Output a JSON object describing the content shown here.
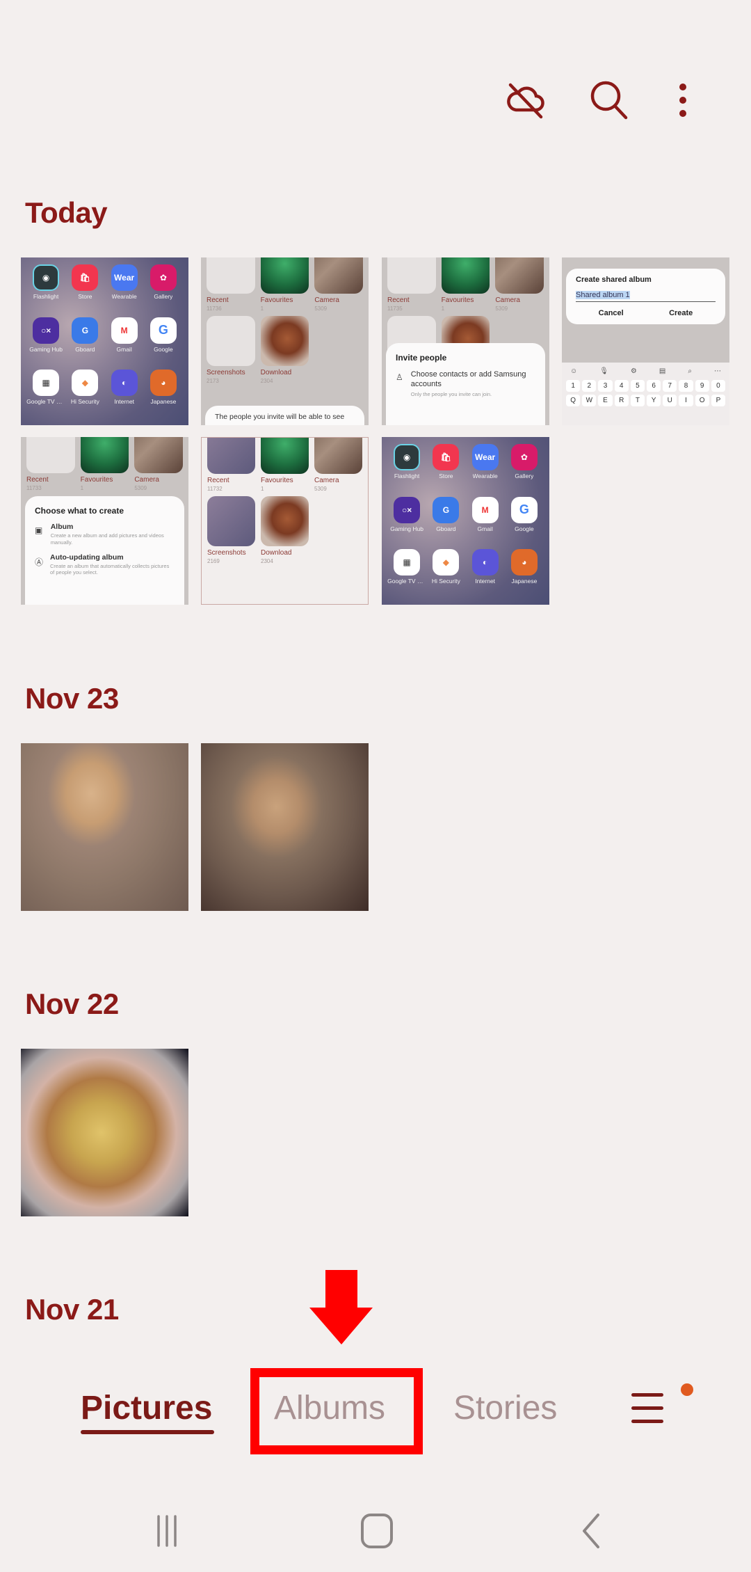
{
  "topbar": {
    "icons": [
      {
        "name": "cloud-off-icon",
        "label": "Cloud sync off"
      },
      {
        "name": "search-icon",
        "label": "Search"
      },
      {
        "name": "more-options-icon",
        "label": "More options"
      }
    ]
  },
  "colors": {
    "accent": "#8b1a18",
    "background": "#f3efee",
    "inactive_tab": "#a89192",
    "badge": "#e05a1f",
    "annotation": "#ff0000"
  },
  "sections": [
    {
      "date": "Today",
      "thumbnails": [
        {
          "kind": "home-screen",
          "apps": [
            "Flashlight",
            "Store",
            "Wearable",
            "Gallery",
            "Gaming Hub",
            "Gboard",
            "Gmail",
            "Google",
            "Google TV Re...",
            "Hi Security",
            "Internet",
            "Japanese"
          ]
        },
        {
          "kind": "albums-with-sheet",
          "albums": [
            {
              "name": "Recent",
              "count": "11736"
            },
            {
              "name": "Favourites",
              "count": "1"
            },
            {
              "name": "Camera",
              "count": "5309"
            },
            {
              "name": "Screenshots",
              "count": "2173"
            },
            {
              "name": "Download",
              "count": "2304"
            }
          ],
          "sheet_text": "The people you invite will be able to see"
        },
        {
          "kind": "invite-people",
          "albums": [
            {
              "name": "Recent",
              "count": "11735"
            },
            {
              "name": "Favourites",
              "count": "1"
            },
            {
              "name": "Camera",
              "count": "5309"
            }
          ],
          "sheet_title": "Invite people",
          "option_title": "Choose contacts or add Samsung accounts",
          "option_desc": "Only the people you invite can join."
        },
        {
          "kind": "create-shared-album",
          "dialog_title": "Create shared album",
          "input_value": "Shared album 1",
          "cancel": "Cancel",
          "create": "Create",
          "keyboard_numbers": [
            "1",
            "2",
            "3",
            "4",
            "5",
            "6",
            "7",
            "8",
            "9",
            "0"
          ],
          "keyboard_letters": [
            "Q",
            "W",
            "E",
            "R",
            "T",
            "Y",
            "U",
            "I",
            "O",
            "P"
          ]
        },
        {
          "kind": "choose-what-to-create",
          "albums": [
            {
              "name": "Recent",
              "count": "11733"
            },
            {
              "name": "Favourites",
              "count": "1"
            },
            {
              "name": "Camera",
              "count": "5309"
            }
          ],
          "sheet_title": "Choose what to create",
          "options": [
            {
              "title": "Album",
              "desc": "Create a new album and add pictures and videos manually."
            },
            {
              "title": "Auto-updating album",
              "desc": "Create an album that automatically collects pictures of people you select."
            }
          ]
        },
        {
          "kind": "albums-grid",
          "albums": [
            {
              "name": "Recent",
              "count": "11732"
            },
            {
              "name": "Favourites",
              "count": "1"
            },
            {
              "name": "Camera",
              "count": "5309"
            },
            {
              "name": "Screenshots",
              "count": "2169"
            },
            {
              "name": "Download",
              "count": "2304"
            }
          ]
        },
        {
          "kind": "home-screen",
          "apps": [
            "Flashlight",
            "Store",
            "Wearable",
            "Gallery",
            "Gaming Hub",
            "Gboard",
            "Gmail",
            "Google",
            "Google TV Re...",
            "Hi Security",
            "Internet",
            "Japanese"
          ]
        }
      ]
    },
    {
      "date": "Nov 23",
      "thumbnails": [
        {
          "kind": "photo",
          "subject": "puppy on couch"
        },
        {
          "kind": "photo",
          "subject": "puppy on couch"
        }
      ]
    },
    {
      "date": "Nov 22",
      "thumbnails": [
        {
          "kind": "photo",
          "subject": "pizza"
        }
      ]
    },
    {
      "date": "Nov 21",
      "thumbnails": []
    }
  ],
  "bottom_tabs": [
    {
      "label": "Pictures",
      "active": true
    },
    {
      "label": "Albums",
      "active": false,
      "highlighted": true
    },
    {
      "label": "Stories",
      "active": false
    }
  ],
  "menu": {
    "has_badge": true
  },
  "system_nav": [
    "recents-button",
    "home-button",
    "back-button"
  ]
}
